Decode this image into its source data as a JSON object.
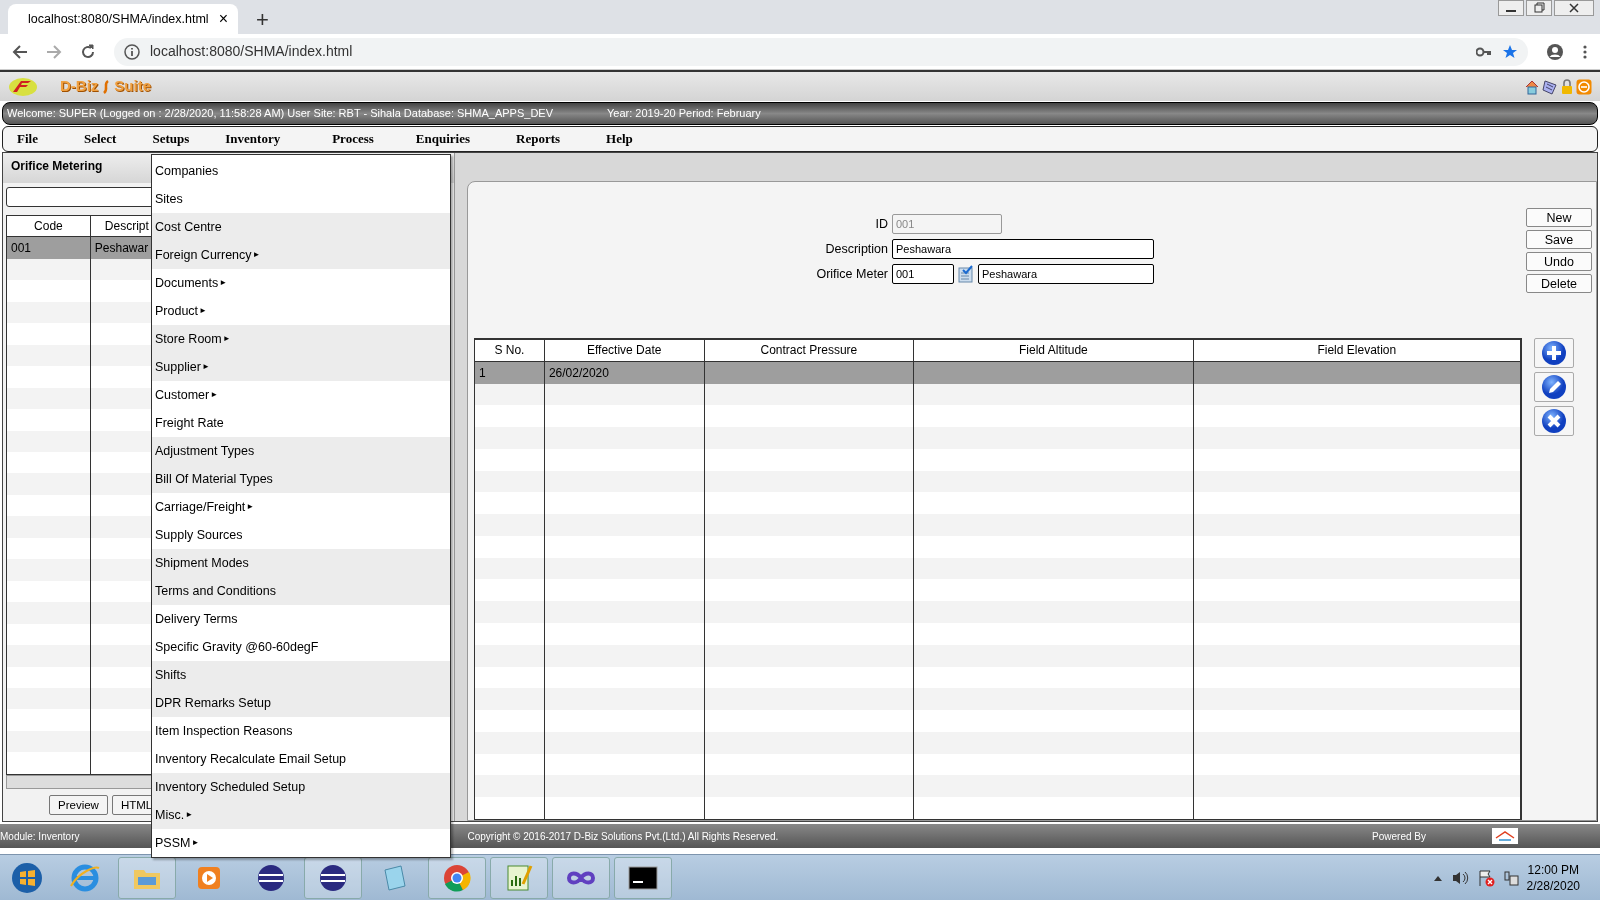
{
  "browser": {
    "tab_title": "localhost:8080/SHMA/index.html",
    "tab_close": "×",
    "new_tab": "+",
    "address": "localhost:8080/SHMA/index.html"
  },
  "app": {
    "logo_text_1": "D-Biz",
    "logo_text_2": "Suite"
  },
  "status": {
    "welcome": "Welcome: SUPER (Logged on : 2/28/2020, 11:58:28 AM) User Site: RBT - Sihala Database: SHMA_APPS_DEV",
    "period": "Year: 2019-20 Period: February"
  },
  "menu": [
    "File",
    "Select",
    "Setups",
    "Inventory",
    "Process",
    "Enquiries",
    "Reports",
    "Help"
  ],
  "setups_menu": [
    {
      "label": "Companies"
    },
    {
      "label": "Sites"
    },
    {
      "label": "Cost Centre"
    },
    {
      "label": "Foreign Currency",
      "arrow": "►"
    },
    {
      "label": "Documents",
      "arrow": "►"
    },
    {
      "label": "Product",
      "arrow": "►"
    },
    {
      "label": "Store Room",
      "arrow": "►"
    },
    {
      "label": "Supplier",
      "arrow": "►"
    },
    {
      "label": "Customer",
      "arrow": "►"
    },
    {
      "label": "Freight Rate"
    },
    {
      "label": "Adjustment Types"
    },
    {
      "label": "Bill Of Material Types"
    },
    {
      "label": "Carriage/Freight",
      "arrow": "►"
    },
    {
      "label": "Supply Sources"
    },
    {
      "label": "Shipment Modes"
    },
    {
      "label": "Terms and Conditions"
    },
    {
      "label": "Delivery Terms"
    },
    {
      "label": "Specific Gravity @60-60degF"
    },
    {
      "label": "Shifts"
    },
    {
      "label": "DPR Remarks Setup"
    },
    {
      "label": "Item Inspection Reasons"
    },
    {
      "label": "Inventory Recalculate Email Setup"
    },
    {
      "label": "Inventory Scheduled Setup"
    },
    {
      "label": "Misc.",
      "arrow": "►"
    },
    {
      "label": "PSSM",
      "arrow": "►"
    }
  ],
  "list_panel": {
    "title": "Orifice Metering",
    "columns": [
      "Code",
      "Descript"
    ],
    "rows": [
      {
        "cells": [
          "001",
          "Peshawar"
        ],
        "selected": true
      }
    ],
    "buttons": [
      "Preview",
      "HTML"
    ]
  },
  "form": {
    "fields": [
      {
        "kind": "text",
        "label": "ID",
        "value": "001",
        "disabled": true
      },
      {
        "kind": "text",
        "label": "Description",
        "value": "Peshawara",
        "disabled": false
      },
      {
        "kind": "lookup",
        "label": "Orifice Meter",
        "value": "001",
        "value_2": "Peshawara",
        "disabled": false
      }
    ],
    "buttons": [
      "New",
      "Save",
      "Undo",
      "Delete"
    ]
  },
  "grid": {
    "columns": [
      "S No.",
      "Effective Date",
      "Contract Pressure",
      "Field Altitude",
      "Field Elevation"
    ],
    "rows": [
      {
        "cells": [
          "1",
          "26/02/2020"
        ],
        "selected": true
      }
    ]
  },
  "footer": {
    "module": "Module: Inventory",
    "copyright": "Copyright © 2016-2017 D-Biz Solutions Pvt.(Ltd.) All Rights Reserved.",
    "powered_by": "Powered By"
  },
  "taskbar": {
    "clock_time": "12:00 PM",
    "clock_date": "2/28/2020"
  }
}
